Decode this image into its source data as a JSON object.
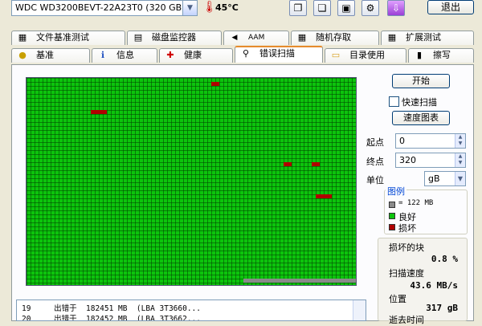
{
  "toolbar": {
    "drive": "WDC WD3200BEVT-22A23T0 (320 GB)",
    "temperature": "45°C",
    "exit_label": "退出",
    "icons": [
      "copy-icon",
      "copy-info-icon",
      "save-icon",
      "options-icon",
      "download-icon"
    ]
  },
  "tabs_row1": [
    {
      "label": "文件基准测试",
      "icon": "file-benchmark-icon",
      "glyph": "▦"
    },
    {
      "label": "磁盘监控器",
      "icon": "disk-monitor-icon",
      "glyph": "▤"
    },
    {
      "label": "AAM",
      "icon": "speaker-icon",
      "glyph": "◀"
    },
    {
      "label": "随机存取",
      "icon": "random-access-icon",
      "glyph": "▦"
    },
    {
      "label": "扩展测试",
      "icon": "extended-test-icon",
      "glyph": "▦"
    }
  ],
  "tabs_row2": [
    {
      "label": "基准",
      "icon": "benchmark-icon",
      "glyph": "●"
    },
    {
      "label": "信息",
      "icon": "info-icon",
      "glyph": "ℹ"
    },
    {
      "label": "健康",
      "icon": "health-icon",
      "glyph": "✚"
    },
    {
      "label": "错误扫描",
      "icon": "magnifier-icon",
      "glyph": "⚲",
      "active": true
    },
    {
      "label": "目录使用",
      "icon": "folder-icon",
      "glyph": "▭"
    },
    {
      "label": "擦写",
      "icon": "trash-icon",
      "glyph": "▮"
    }
  ],
  "controls": {
    "start_label": "开始",
    "quick_scan_label": "快速扫描",
    "quick_scan_checked": false,
    "speed_map_label": "速度图表",
    "start_point_label": "起点",
    "start_point_value": "0",
    "end_point_label": "终点",
    "end_point_value": "320",
    "unit_label": "单位",
    "unit_value": "gB"
  },
  "legend": {
    "title": "图例",
    "items": [
      {
        "text": "= 122 MB",
        "color": "#8a8a8a"
      },
      {
        "text": "良好",
        "color": "#0dc40d"
      },
      {
        "text": "损坏",
        "color": "#b00000"
      }
    ]
  },
  "stats": {
    "damaged_label": "损坏的块",
    "damaged_value": "0.8 %",
    "speed_label": "扫描速度",
    "speed_value": "43.6 MB/s",
    "position_label": "位置",
    "position_value": "317 gB",
    "elapsed_label": "逝去时间"
  },
  "scan": {
    "good_color": "#0dc40d",
    "bad_color": "#b00000",
    "scanned_fraction": 0.99
  },
  "log": [
    {
      "n": "19",
      "text": "出错于  182451 MB  (LBA 3T3660..."
    },
    {
      "n": "20",
      "text": "出错于  182452 MB  (LBA 3T3662..."
    }
  ]
}
